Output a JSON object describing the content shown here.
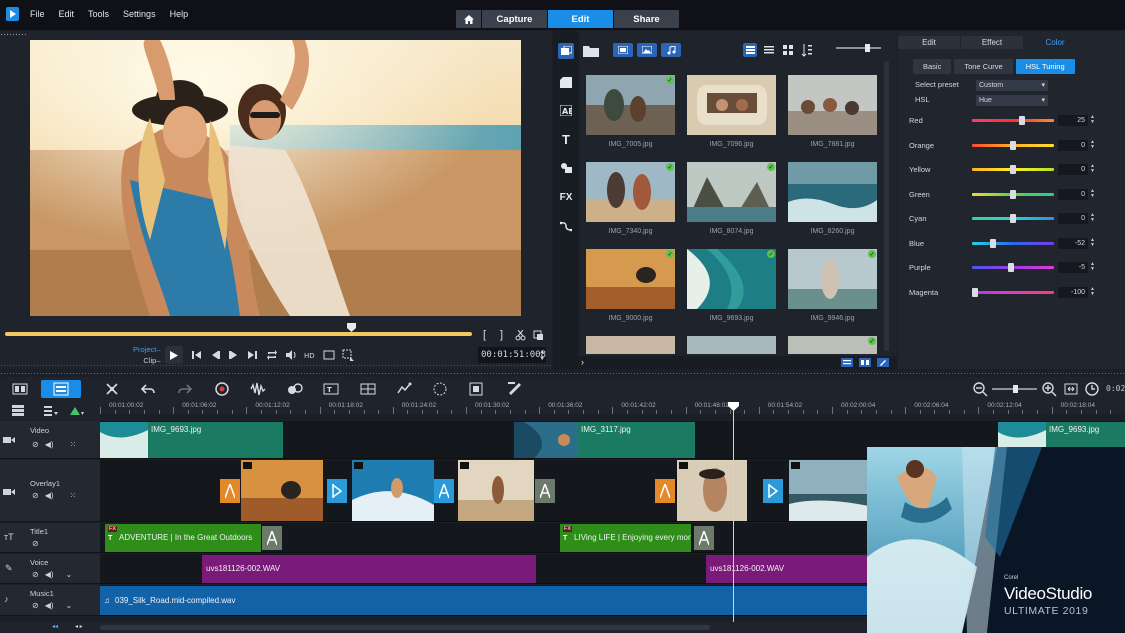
{
  "menu": [
    "File",
    "Edit",
    "Tools",
    "Settings",
    "Help"
  ],
  "modes": [
    "Capture",
    "Edit",
    "Share"
  ],
  "preview": {
    "project_label": "Project",
    "clip_label": "Clip",
    "timecode": "00:01:51:008"
  },
  "library": {
    "thumbnails": [
      {
        "name": "IMG_7005.jpg"
      },
      {
        "name": "IMG_7096.jpg"
      },
      {
        "name": "IMG_7881.jpg"
      },
      {
        "name": "IMG_7340.jpg"
      },
      {
        "name": "IMG_8074.jpg"
      },
      {
        "name": "IMG_8260.jpg"
      },
      {
        "name": "IMG_9000.jpg"
      },
      {
        "name": "IMG_9693.jpg"
      },
      {
        "name": "IMG_9946.jpg"
      }
    ]
  },
  "options": {
    "tabs": [
      "Edit",
      "Effect",
      "Color"
    ],
    "subtabs": [
      "Basic",
      "Tone Curve",
      "HSL Tuning"
    ],
    "select_preset_label": "Select preset",
    "preset_value": "Custom",
    "hsl_label": "HSL",
    "hsl_value": "Hue",
    "rows": [
      {
        "name": "Red",
        "value": "25",
        "level": 0.62
      },
      {
        "name": "Orange",
        "value": "0",
        "level": 0.5
      },
      {
        "name": "Yellow",
        "value": "0",
        "level": 0.5
      },
      {
        "name": "Green",
        "value": "0",
        "level": 0.5
      },
      {
        "name": "Cyan",
        "value": "0",
        "level": 0.5
      },
      {
        "name": "Blue",
        "value": "-52",
        "level": 0.24
      },
      {
        "name": "Purple",
        "value": "-5",
        "level": 0.48
      },
      {
        "name": "Magenta",
        "value": "-100",
        "level": 0.0
      }
    ]
  },
  "ruler": [
    "00:01:00:02",
    "00:01:06:02",
    "00:01:12:02",
    "00:01:18:02",
    "00:01:24:02",
    "00:01:30:02",
    "00:01:36:02",
    "00:01:42:02",
    "00:01:48:02",
    "00:01:54:02",
    "00:02:00:04",
    "00:02:06:04",
    "00:02:12:04",
    "00:02:18:04"
  ],
  "tracks": {
    "video": "Video",
    "overlay": "Overlay1",
    "title": "Title1",
    "voice": "Voice",
    "music": "Music1"
  },
  "clips": {
    "video1": "IMG_9693.jpg",
    "video2": "IMG_3117.jpg",
    "video3": "IMG_9693.jpg",
    "title1": "ADVENTURE | In the Great Outdoors",
    "title2": "LIVing LIFE | Enjoying every mon",
    "voice1": "uvs181126-002.WAV",
    "voice2": "uvs181126-002.WAV",
    "music1": "039_Silk_Road.mid-compiled.wav",
    "fx_badge": "FX"
  },
  "promo": {
    "corel": "Corel",
    "brand": "VideoStudio",
    "edition": "ULTIMATE 2019"
  },
  "colors": {
    "accent": "#1a8ee6",
    "video_clip": "#1b7a62",
    "title_clip": "#2f8d19",
    "voice_clip": "#7a1b7a",
    "music_clip": "#1262a8"
  }
}
